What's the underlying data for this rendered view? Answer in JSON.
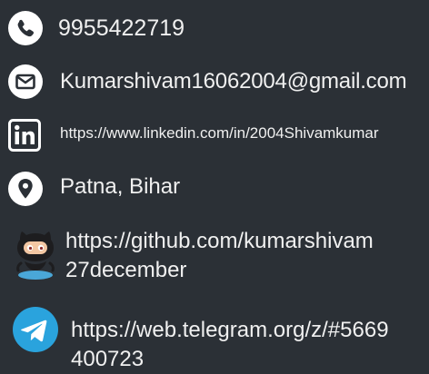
{
  "contacts": {
    "phone": {
      "value": "9955422719",
      "icon": "phone-icon"
    },
    "email": {
      "value": "Kumarshivam16062004@gmail.com",
      "icon": "email-icon"
    },
    "linkedin": {
      "value": "https://www.linkedin.com/in/2004Shivamkumar",
      "icon": "linkedin-icon"
    },
    "location": {
      "value": "Patna, Bihar",
      "icon": "location-pin-icon"
    },
    "github": {
      "value": "https://github.com/kumarshivam27december",
      "icon": "github-octocat-icon"
    },
    "telegram": {
      "value": "https://web.telegram.org/z/#5669400723",
      "icon": "telegram-icon"
    }
  },
  "colors": {
    "background": "#2b3036",
    "text": "#f0f0f0",
    "icon_white": "#ffffff",
    "telegram_blue": "#2aa3dd"
  }
}
